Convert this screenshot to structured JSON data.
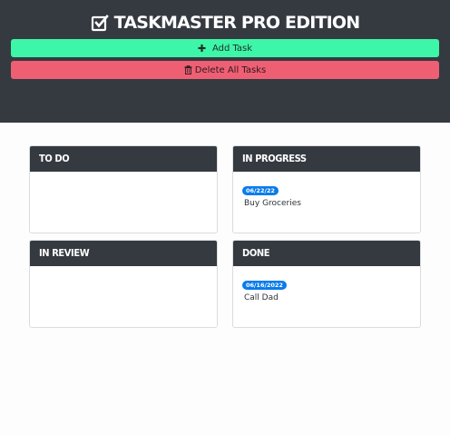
{
  "header": {
    "title": "TASKMASTER PRO EDITION",
    "add_label": "Add Task",
    "delete_label": "Delete All Tasks"
  },
  "columns": {
    "todo": {
      "title": "TO DO"
    },
    "inprogress": {
      "title": "IN PROGRESS",
      "task": {
        "date": "06/22/22",
        "text": "Buy Groceries"
      }
    },
    "inreview": {
      "title": "IN REVIEW"
    },
    "done": {
      "title": "DONE",
      "task": {
        "date": "06/16/2022",
        "text": "Call Dad"
      }
    }
  },
  "colors": {
    "header_bg": "#343a40",
    "add_button": "#3ef6a8",
    "delete_button": "#ef5f73",
    "badge": "#0a7bea"
  },
  "icons": [
    "check-square-icon",
    "plus-icon",
    "trash-icon"
  ]
}
